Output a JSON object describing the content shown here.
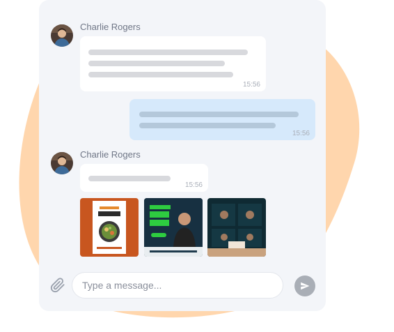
{
  "colors": {
    "background_blob": "#ffd6ad",
    "panel": "#f3f5f9",
    "incoming_bubble": "#ffffff",
    "outgoing_bubble": "#d6e9fb",
    "send_button": "#a9aeb6"
  },
  "messages": [
    {
      "sender": "Charlie Rogers",
      "direction": "incoming",
      "time": "15:56"
    },
    {
      "sender": "",
      "direction": "outgoing",
      "time": "15:56"
    },
    {
      "sender": "Charlie Rogers",
      "direction": "incoming",
      "time": "15:56"
    }
  ],
  "attachments": [
    {
      "icon": "food-menu-poster-thumbnail"
    },
    {
      "icon": "business-poster-thumbnail"
    },
    {
      "icon": "dark-template-grid-thumbnail"
    }
  ],
  "composer": {
    "placeholder": "Type a message...",
    "attach_icon": "paperclip-icon",
    "send_icon": "send-icon"
  }
}
